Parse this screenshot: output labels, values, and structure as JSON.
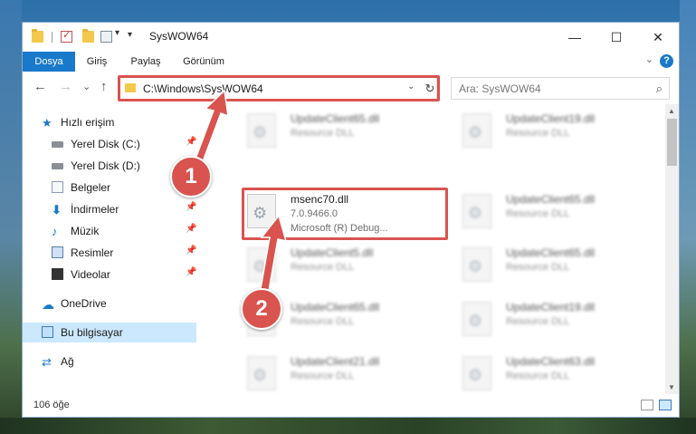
{
  "window": {
    "title": "SysWOW64",
    "controls": {
      "minimize": "—",
      "maximize": "☐",
      "close": "✕"
    }
  },
  "ribbon": {
    "tabs": [
      "Dosya",
      "Giriş",
      "Paylaş",
      "Görünüm"
    ],
    "active_tab": "Dosya",
    "help": "?",
    "collapse": "⌄"
  },
  "navbar": {
    "back": "←",
    "forward": "→",
    "recent": "⌄",
    "up": "↑",
    "address": "C:\\Windows\\SysWOW64",
    "address_chevron": "⌄",
    "refresh": "↻",
    "search_placeholder": "Ara: SysWOW64",
    "search_icon": "⌕"
  },
  "sidebar": {
    "items": [
      {
        "label": "Hızlı erişim",
        "icon": "star-icon",
        "pinned": false
      },
      {
        "label": "Yerel Disk (C:)",
        "icon": "disk-icon",
        "pinned": true
      },
      {
        "label": "Yerel Disk (D:)",
        "icon": "disk-icon",
        "pinned": true
      },
      {
        "label": "Belgeler",
        "icon": "documents-icon",
        "pinned": true
      },
      {
        "label": "İndirmeler",
        "icon": "downloads-icon",
        "pinned": true
      },
      {
        "label": "Müzik",
        "icon": "music-icon",
        "pinned": true
      },
      {
        "label": "Resimler",
        "icon": "pictures-icon",
        "pinned": true
      },
      {
        "label": "Videolar",
        "icon": "videos-icon",
        "pinned": true
      },
      {
        "label": "OneDrive",
        "icon": "cloud-icon",
        "pinned": false
      },
      {
        "label": "Bu bilgisayar",
        "icon": "computer-icon",
        "pinned": false,
        "selected": true
      },
      {
        "label": "Ağ",
        "icon": "network-icon",
        "pinned": false
      }
    ],
    "pin_glyph": "📌"
  },
  "files": [
    {
      "name": "UpdateClient65.dll",
      "desc": "Resource DLL"
    },
    {
      "name": "UpdateClient19.dll",
      "desc": "Resource DLL"
    },
    {
      "name": "msenc70.dll",
      "version": "7.0.9466.0",
      "company": "Microsoft (R) Debug..."
    },
    {
      "name": "UpdateClient65.dll",
      "desc": "Resource DLL"
    },
    {
      "name": "UpdateClient5.dll",
      "desc": "Resource DLL"
    },
    {
      "name": "UpdateClient65.dll",
      "desc": "Resource DLL"
    },
    {
      "name": "UpdateClient65.dll",
      "desc": "Resource DLL"
    },
    {
      "name": "UpdateClient19.dll",
      "desc": "Resource DLL"
    },
    {
      "name": "UpdateClient21.dll",
      "desc": "Resource DLL"
    },
    {
      "name": "UpdateClient63.dll",
      "desc": "Resource DLL"
    }
  ],
  "status": {
    "count": "106 öğe"
  },
  "callouts": {
    "step1": "1",
    "step2": "2"
  },
  "colors": {
    "accent": "#1979ca",
    "callout": "#d9534f",
    "selection": "#cce8ff"
  }
}
